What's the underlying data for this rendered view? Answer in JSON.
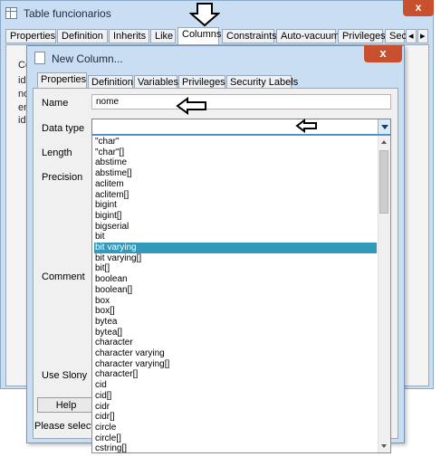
{
  "outer": {
    "title": "Table funcionarios",
    "close": "x",
    "tabs": [
      "Properties",
      "Definition",
      "Inherits",
      "Like",
      "Columns",
      "Constraints",
      "Auto-vacuum",
      "Privileges",
      "Sec"
    ],
    "active_tab": "Columns",
    "left_fragments": [
      "Co",
      "id",
      "no",
      "en",
      "id"
    ]
  },
  "dialog": {
    "title": "New Column...",
    "close": "x",
    "tabs": [
      "Properties",
      "Definition",
      "Variables",
      "Privileges",
      "Security Labels"
    ],
    "active_tab": "Properties",
    "labels": {
      "name": "Name",
      "data_type": "Data type",
      "length": "Length",
      "precision": "Precision",
      "comment": "Comment",
      "use_slony": "Use Slony"
    },
    "name_value": "nome",
    "data_type_value": "",
    "help_button": "Help",
    "status": "Please select a"
  },
  "dropdown": {
    "selected": "bit varying",
    "options": [
      "\"char\"",
      "\"char\"[]",
      "abstime",
      "abstime[]",
      "aclitem",
      "aclitem[]",
      "bigint",
      "bigint[]",
      "bigserial",
      "bit",
      "bit varying",
      "bit varying[]",
      "bit[]",
      "boolean",
      "boolean[]",
      "box",
      "box[]",
      "bytea",
      "bytea[]",
      "character",
      "character varying",
      "character varying[]",
      "character[]",
      "cid",
      "cid[]",
      "cidr",
      "cidr[]",
      "circle",
      "circle[]",
      "cstring[]"
    ]
  },
  "colors": {
    "selection": "#3399bb",
    "close_button": "#c9502f",
    "window_frame": "#c9def3"
  }
}
